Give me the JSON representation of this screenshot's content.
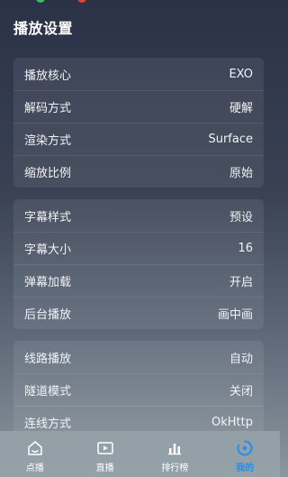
{
  "page": {
    "title": "播放设置"
  },
  "colors": {
    "accent": "#1f8ef1",
    "status_green": "#3dbd5d",
    "status_red": "#e0453a"
  },
  "groups": [
    {
      "rows": [
        {
          "label": "播放核心",
          "value": "EXO"
        },
        {
          "label": "解码方式",
          "value": "硬解"
        },
        {
          "label": "渲染方式",
          "value": "Surface"
        },
        {
          "label": "缩放比例",
          "value": "原始"
        }
      ]
    },
    {
      "rows": [
        {
          "label": "字幕样式",
          "value": "预设"
        },
        {
          "label": "字幕大小",
          "value": "16"
        },
        {
          "label": "弹幕加载",
          "value": "开启"
        },
        {
          "label": "后台播放",
          "value": "画中画"
        }
      ]
    },
    {
      "rows": [
        {
          "label": "线路播放",
          "value": "自动"
        },
        {
          "label": "隧道模式",
          "value": "关闭"
        },
        {
          "label": "连线方式",
          "value": "OkHttp"
        }
      ]
    }
  ],
  "nav": [
    {
      "label": "点播",
      "icon": "home-icon",
      "active": false
    },
    {
      "label": "直播",
      "icon": "live-tv-icon",
      "active": false
    },
    {
      "label": "排行榜",
      "icon": "bar-chart-icon",
      "active": false
    },
    {
      "label": "我的",
      "icon": "user-circle-icon",
      "active": true
    }
  ]
}
